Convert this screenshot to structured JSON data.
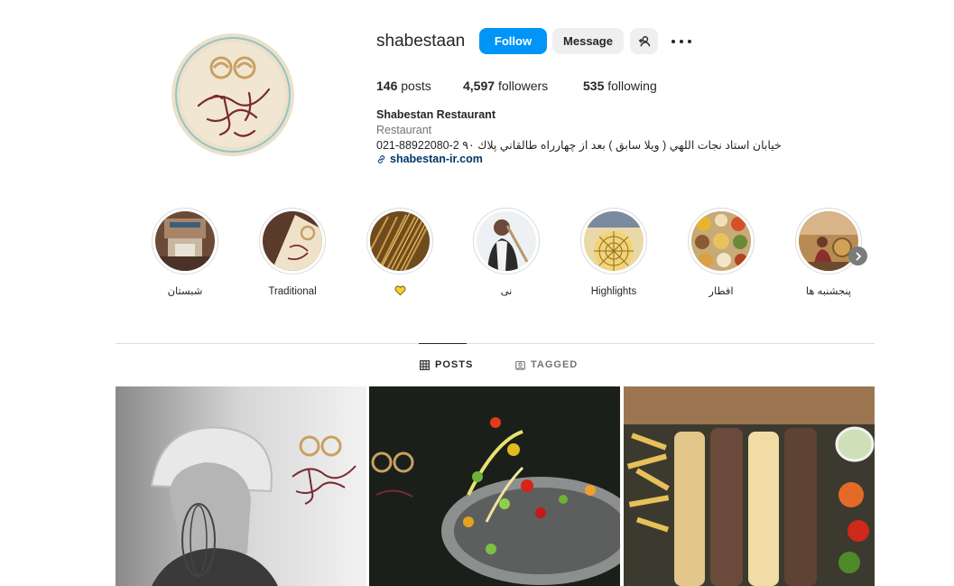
{
  "profile": {
    "username": "shabestaan",
    "follow_label": "Follow",
    "message_label": "Message",
    "stats": {
      "posts_count": "146",
      "posts_label": "posts",
      "followers_count": "4,597",
      "followers_label": "followers",
      "following_count": "535",
      "following_label": "following"
    },
    "bio": {
      "name": "Shabestan Restaurant",
      "category": "Restaurant",
      "address": "021-88922080-2 خيابان استاد نجات اللهي ( ويلا سابق ) بعد از چهارراه طالقاني پلاك ٩٠",
      "link": "shabestan-ir.com"
    },
    "avatar_logo_text": "سفره خانه شبستان"
  },
  "highlights": [
    {
      "label": "شبستان"
    },
    {
      "label": "Traditional"
    },
    {
      "label": ""
    },
    {
      "label": "نی"
    },
    {
      "label": "Highlights"
    },
    {
      "label": "افطار"
    },
    {
      "label": "پنجشنبه ها"
    }
  ],
  "tabs": {
    "posts": "POSTS",
    "tagged": "TAGGED"
  },
  "icons": {
    "add_user": "add-user-icon",
    "more": "more-options-icon",
    "link": "link-icon",
    "heart_emoji": "yellow-heart-icon",
    "next": "chevron-right-icon",
    "grid": "grid-icon",
    "tagged": "tagged-icon"
  },
  "colors": {
    "follow_blue": "#0095f6",
    "link_blue": "#00376b",
    "muted": "#737373",
    "gold": "#c9a063"
  }
}
